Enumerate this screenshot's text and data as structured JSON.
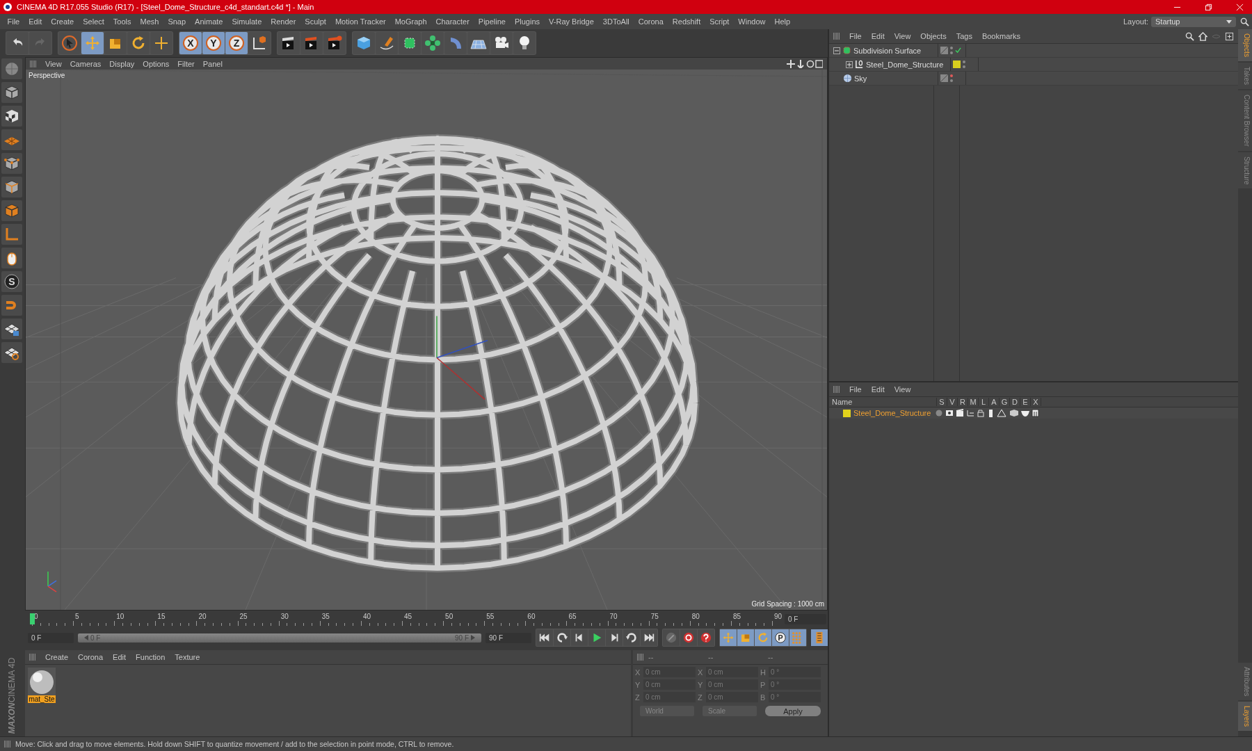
{
  "window": {
    "title": "CINEMA 4D R17.055 Studio (R17) - [Steel_Dome_Structure_c4d_standart.c4d *] - Main"
  },
  "menu": [
    "File",
    "Edit",
    "Create",
    "Select",
    "Tools",
    "Mesh",
    "Snap",
    "Animate",
    "Simulate",
    "Render",
    "Sculpt",
    "Motion Tracker",
    "MoGraph",
    "Character",
    "Pipeline",
    "Plugins",
    "V-Ray Bridge",
    "3DToAll",
    "Corona",
    "Redshift",
    "Script",
    "Window",
    "Help"
  ],
  "layout": {
    "label": "Layout:",
    "value": "Startup"
  },
  "toolbar": [
    [
      {
        "kind": "undo",
        "selected": false
      },
      {
        "kind": "redo",
        "selected": false
      }
    ],
    [
      {
        "kind": "select",
        "selected": false
      },
      {
        "kind": "move",
        "selected": true
      },
      {
        "kind": "scale",
        "selected": false
      },
      {
        "kind": "rotate",
        "selected": false
      },
      {
        "kind": "transform",
        "selected": false
      }
    ],
    [
      {
        "kind": "axis-lock",
        "label": "X",
        "selected": true
      },
      {
        "kind": "axis-lock",
        "label": "Y",
        "selected": true
      },
      {
        "kind": "axis-lock",
        "label": "Z",
        "selected": true
      },
      {
        "kind": "coord",
        "selected": false
      }
    ],
    [
      {
        "kind": "render-view",
        "selected": false
      },
      {
        "kind": "render",
        "selected": false
      },
      {
        "kind": "render-settings",
        "selected": false
      }
    ],
    [
      {
        "kind": "cube",
        "selected": false
      },
      {
        "kind": "pen",
        "selected": false
      },
      {
        "kind": "subdivide",
        "selected": false
      },
      {
        "kind": "cloner",
        "selected": false
      },
      {
        "kind": "deformer",
        "selected": false
      },
      {
        "kind": "floor",
        "selected": false
      },
      {
        "kind": "camera",
        "selected": false
      },
      {
        "kind": "light",
        "selected": false
      }
    ]
  ],
  "left_toolbar": [
    {
      "kind": "editable"
    },
    {
      "kind": "model"
    },
    {
      "kind": "texture"
    },
    {
      "kind": "workplane"
    },
    {
      "kind": "points"
    },
    {
      "kind": "edges"
    },
    {
      "kind": "polygons"
    },
    {
      "kind": "axis"
    },
    {
      "kind": "tweak"
    },
    {
      "kind": "snap",
      "label": "S"
    },
    {
      "kind": "magnet"
    },
    {
      "kind": "grid-lock"
    },
    {
      "kind": "grid-axis"
    }
  ],
  "brand": {
    "line_1": "MAXON",
    "line_2": "CINEMA 4D"
  },
  "viewport": {
    "menu": [
      "View",
      "Cameras",
      "Display",
      "Options",
      "Filter",
      "Panel"
    ],
    "camera": "Perspective",
    "grid_spacing": "Grid Spacing : 1000 cm"
  },
  "timeline": {
    "ticks": [
      "0",
      "5",
      "10",
      "15",
      "20",
      "25",
      "30",
      "35",
      "40",
      "45",
      "50",
      "55",
      "60",
      "65",
      "70",
      "75",
      "80",
      "85",
      "90"
    ],
    "playhead": {
      "level": 0
    },
    "current_field": "0 F",
    "start_field": "0 F",
    "slider_start": "0 F",
    "slider_end": "90 F",
    "range": {
      "level": 1
    },
    "end_field": "90 F"
  },
  "transport": [
    {
      "kind": "first"
    },
    {
      "kind": "prev-key"
    },
    {
      "kind": "prev-frame"
    },
    {
      "kind": "play"
    },
    {
      "kind": "next-frame"
    },
    {
      "kind": "next-key"
    },
    {
      "kind": "last"
    }
  ],
  "record": [
    {
      "kind": "keyframe-off"
    },
    {
      "kind": "record"
    },
    {
      "kind": "autokey"
    }
  ],
  "key_filters": [
    {
      "kind": "move",
      "selected": true
    },
    {
      "kind": "scale",
      "selected": true
    },
    {
      "kind": "rotate",
      "selected": true
    },
    {
      "kind": "param",
      "label": "P",
      "selected": true
    },
    {
      "kind": "points",
      "selected": true
    }
  ],
  "material_manager": {
    "menu": [
      "Create",
      "Corona",
      "Edit",
      "Function",
      "Texture"
    ],
    "materials": [
      {
        "name": "mat_Ste",
        "selected": true
      }
    ]
  },
  "coordinates": {
    "headers": [
      "--",
      "--",
      "--"
    ],
    "rows": [
      {
        "labels": [
          "X",
          "X",
          "H"
        ],
        "values": [
          "0 cm",
          "0 cm",
          "0 °"
        ]
      },
      {
        "labels": [
          "Y",
          "Y",
          "P"
        ],
        "values": [
          "0 cm",
          "0 cm",
          "0 °"
        ]
      },
      {
        "labels": [
          "Z",
          "Z",
          "B"
        ],
        "values": [
          "0 cm",
          "0 cm",
          "0 °"
        ]
      }
    ],
    "mode": "World",
    "transform": "Scale",
    "apply": "Apply"
  },
  "object_manager": {
    "menu": [
      "File",
      "Edit",
      "View",
      "Objects",
      "Tags",
      "Bookmarks"
    ],
    "objects": [
      {
        "name": "Subdivision Surface",
        "kind": "subdivision",
        "expanded": true,
        "enabled": true,
        "editor_visible": true,
        "children": [
          {
            "name": "Steel_Dome_Structure",
            "kind": "null",
            "expanded": false,
            "color": "#d9cf1e",
            "editor_visible": true
          }
        ]
      },
      {
        "name": "Sky",
        "kind": "sky",
        "editor_visible": false
      }
    ]
  },
  "layer_manager": {
    "menu": [
      "File",
      "Edit",
      "View"
    ],
    "columns": [
      "Name",
      "S",
      "V",
      "R",
      "M",
      "L",
      "A",
      "G",
      "D",
      "E",
      "X"
    ],
    "layers": [
      {
        "name": "Steel_Dome_Structure",
        "color": "#e2d21c",
        "selected": true
      }
    ]
  },
  "side_tabs_top": [
    {
      "label": "Objects",
      "selected": true
    },
    {
      "label": "Takes",
      "selected": false
    },
    {
      "label": "Content Browser",
      "selected": false
    },
    {
      "label": "Structure",
      "selected": false
    }
  ],
  "side_tabs_bottom": [
    {
      "label": "Attributes",
      "selected": false
    },
    {
      "label": "Layers",
      "selected": true
    }
  ],
  "status_bar": "Move: Click and drag to move elements. Hold down SHIFT to quantize movement / add to the selection in point mode, CTRL to remove."
}
